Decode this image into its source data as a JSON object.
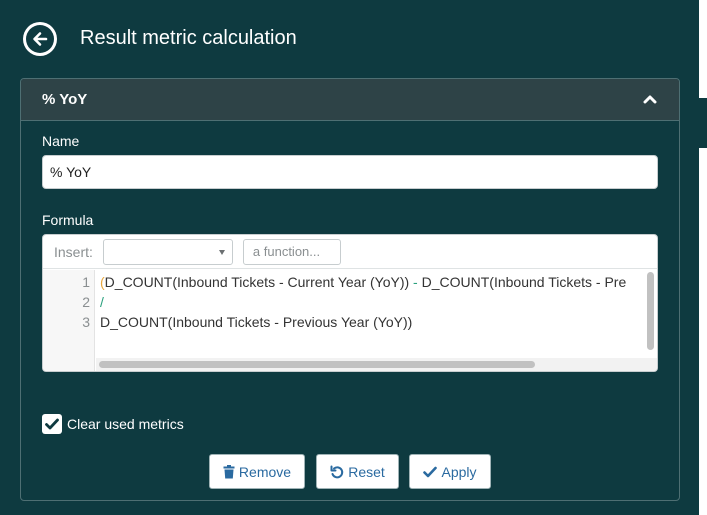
{
  "page": {
    "title": "Result metric calculation"
  },
  "panel": {
    "title": "% YoY"
  },
  "name_field": {
    "label": "Name",
    "value": "% YoY"
  },
  "formula": {
    "label": "Formula",
    "insert_label": "Insert:",
    "insert_select_value": "",
    "function_placeholder": "a function...",
    "line_numbers": [
      "1",
      "2",
      "3"
    ],
    "lines": {
      "l1_open": "(",
      "l1_a": "D_COUNT(Inbound Tickets - Current Year (YoY))",
      "l1_op": " - ",
      "l1_b": "D_COUNT(Inbound Tickets - Pre",
      "l2": "/",
      "l3": "D_COUNT(Inbound Tickets - Previous Year (YoY))"
    }
  },
  "clear_used_metrics": {
    "label": "Clear used metrics",
    "checked": true
  },
  "buttons": {
    "remove": "Remove",
    "reset": "Reset",
    "apply": "Apply"
  },
  "icons": {
    "back": "back-arrow-circle-icon",
    "collapse": "chevron-up-icon",
    "checkbox": "checkmark-icon",
    "remove": "trash-icon",
    "reset": "undo-icon",
    "apply": "checkmark-icon"
  },
  "colors": {
    "background": "#0e3a40",
    "panel_header": "#2e4347",
    "button_text": "#2a6aa0",
    "paren": "#e8a73d",
    "operator": "#2aa07d"
  }
}
